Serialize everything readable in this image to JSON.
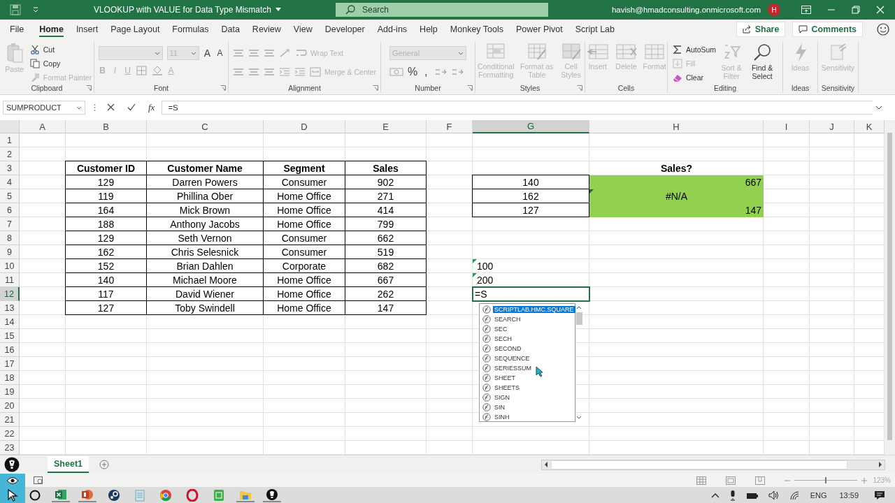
{
  "window": {
    "title": "VLOOKUP with VALUE for Data Type Mismatch",
    "search": {
      "placeholder": "Search"
    },
    "account": "havish@hmadconsulting.onmicrosoft.com",
    "avatar": "H"
  },
  "menu_tabs": [
    {
      "label": "File",
      "selected": false
    },
    {
      "label": "Home",
      "selected": true
    },
    {
      "label": "Insert",
      "selected": false
    },
    {
      "label": "Page Layout",
      "selected": false
    },
    {
      "label": "Formulas",
      "selected": false
    },
    {
      "label": "Data",
      "selected": false
    },
    {
      "label": "Review",
      "selected": false
    },
    {
      "label": "View",
      "selected": false
    },
    {
      "label": "Developer",
      "selected": false
    },
    {
      "label": "Add-ins",
      "selected": false
    },
    {
      "label": "Help",
      "selected": false
    },
    {
      "label": "Monkey Tools",
      "selected": false
    },
    {
      "label": "Power Pivot",
      "selected": false
    },
    {
      "label": "Script Lab",
      "selected": false
    }
  ],
  "share": "Share",
  "comments": "Comments",
  "ribbon": [
    {
      "kind": "clipboard",
      "name": "Clipboard",
      "buttons": [
        {
          "label": "Paste",
          "disabled": true
        },
        {
          "label": "Cut",
          "disabled": false
        },
        {
          "label": "Copy",
          "disabled": false
        },
        {
          "label": "Format Painter",
          "disabled": true
        }
      ]
    },
    {
      "kind": "font",
      "name": "Font",
      "font_size": "11",
      "buttons": [
        {
          "label": "A",
          "disabled": false
        },
        {
          "label": "A",
          "disabled": false
        },
        {
          "label": "B",
          "disabled": true
        },
        {
          "label": "I",
          "disabled": true
        },
        {
          "label": "U",
          "disabled": true
        },
        {
          "label": "A",
          "disabled": true
        }
      ]
    },
    {
      "kind": "alignment",
      "name": "Alignment",
      "buttons": [
        {
          "label": "Wrap Text",
          "disabled": true
        },
        {
          "label": "Merge & Center",
          "disabled": true
        }
      ]
    },
    {
      "kind": "number",
      "name": "Number",
      "format": "General",
      "buttons": [
        {
          "label": "%",
          "disabled": false
        },
        {
          "label": ",",
          "disabled": false
        }
      ]
    },
    {
      "kind": "styles",
      "name": "Styles",
      "buttons": [
        {
          "label": "Conditional Formatting",
          "disabled": true
        },
        {
          "label": "Format as Table",
          "disabled": true
        },
        {
          "label": "Cell Styles",
          "disabled": true
        }
      ]
    },
    {
      "kind": "cells",
      "name": "Cells",
      "buttons": [
        {
          "label": "Insert",
          "disabled": true
        },
        {
          "label": "Delete",
          "disabled": true
        },
        {
          "label": "Format",
          "disabled": true
        }
      ]
    },
    {
      "kind": "editing",
      "name": "Editing",
      "buttons": [
        {
          "label": "AutoSum",
          "disabled": false
        },
        {
          "label": "Fill",
          "disabled": true
        },
        {
          "label": "Clear",
          "disabled": false
        },
        {
          "label": "Sort & Filter",
          "disabled": true
        },
        {
          "label": "Find & Select",
          "disabled": false
        }
      ]
    },
    {
      "kind": "ideas",
      "name": "Ideas",
      "buttons": [
        {
          "label": "Ideas",
          "disabled": true
        }
      ]
    },
    {
      "kind": "sensitivity",
      "name": "Sensitivity",
      "buttons": [
        {
          "label": "Sensitivity",
          "disabled": true
        }
      ]
    }
  ],
  "formula_bar": {
    "name_box": "SUMPRODUCT",
    "function_label": "fx",
    "formula": "=S"
  },
  "sheet": {
    "columns": [
      {
        "label": "A",
        "selected": false
      },
      {
        "label": "B",
        "selected": false
      },
      {
        "label": "C",
        "selected": false
      },
      {
        "label": "D",
        "selected": false
      },
      {
        "label": "E",
        "selected": false
      },
      {
        "label": "F",
        "selected": false
      },
      {
        "label": "G",
        "selected": true
      },
      {
        "label": "H",
        "selected": false
      },
      {
        "label": "I",
        "selected": false
      },
      {
        "label": "J",
        "selected": false
      },
      {
        "label": "K",
        "selected": false
      }
    ],
    "rows": [
      {
        "label": "1",
        "selected": false
      },
      {
        "label": "2",
        "selected": false
      },
      {
        "label": "3",
        "selected": false
      },
      {
        "label": "4",
        "selected": false
      },
      {
        "label": "5",
        "selected": false
      },
      {
        "label": "6",
        "selected": false
      },
      {
        "label": "7",
        "selected": false
      },
      {
        "label": "8",
        "selected": false
      },
      {
        "label": "9",
        "selected": false
      },
      {
        "label": "10",
        "selected": false
      },
      {
        "label": "11",
        "selected": false
      },
      {
        "label": "12",
        "selected": true
      },
      {
        "label": "13",
        "selected": false
      },
      {
        "label": "14",
        "selected": false
      },
      {
        "label": "15",
        "selected": false
      },
      {
        "label": "16",
        "selected": false
      },
      {
        "label": "17",
        "selected": false
      },
      {
        "label": "18",
        "selected": false
      },
      {
        "label": "19",
        "selected": false
      },
      {
        "label": "20",
        "selected": false
      },
      {
        "label": "21",
        "selected": false
      },
      {
        "label": "22",
        "selected": false
      },
      {
        "label": "23",
        "selected": false
      }
    ],
    "table": {
      "columns": [
        "Customer ID",
        "Customer Name",
        "Segment",
        "Sales"
      ],
      "rows": [
        [
          "129",
          "Darren Powers",
          "Consumer",
          "902"
        ],
        [
          "119",
          "Phillina Ober",
          "Home Office",
          "271"
        ],
        [
          "164",
          "Mick Brown",
          "Home Office",
          "414"
        ],
        [
          "188",
          "Anthony Jacobs",
          "Home Office",
          "799"
        ],
        [
          "129",
          "Seth Vernon",
          "Consumer",
          "662"
        ],
        [
          "162",
          "Chris Selesnick",
          "Consumer",
          "519"
        ],
        [
          "152",
          "Brian Dahlen",
          "Corporate",
          "682"
        ],
        [
          "140",
          "Michael Moore",
          "Home Office",
          "667"
        ],
        [
          "117",
          "David Wiener",
          "Home Office",
          "262"
        ],
        [
          "127",
          "Toby Swindell",
          "Home Office",
          "147"
        ]
      ]
    },
    "lookup": {
      "header": "Sales?",
      "rows": [
        {
          "key": "140",
          "result": "667",
          "kind": "number",
          "highlighted": true,
          "warning": false
        },
        {
          "key": "162",
          "result": "#N/A",
          "kind": "error",
          "highlighted": true,
          "warning": true
        },
        {
          "key": "127",
          "result": "147",
          "kind": "number",
          "highlighted": true,
          "warning": false
        }
      ]
    },
    "text_values": [
      {
        "text": "100",
        "warning": true
      },
      {
        "text": "200",
        "warning": true
      }
    ],
    "active_cell": {
      "text": "=S"
    },
    "autocomplete": [
      {
        "label": "SCRIPTLAB.HMC.SQUARE",
        "selected": true
      },
      {
        "label": "SEARCH",
        "selected": false
      },
      {
        "label": "SEC",
        "selected": false
      },
      {
        "label": "SECH",
        "selected": false
      },
      {
        "label": "SECOND",
        "selected": false
      },
      {
        "label": "SEQUENCE",
        "selected": false
      },
      {
        "label": "SERIESSUM",
        "selected": false
      },
      {
        "label": "SHEET",
        "selected": false
      },
      {
        "label": "SHEETS",
        "selected": false
      },
      {
        "label": "SIGN",
        "selected": false
      },
      {
        "label": "SIN",
        "selected": false
      },
      {
        "label": "SINH",
        "selected": false
      }
    ]
  },
  "sheet_tabs": [
    {
      "label": "Sheet1",
      "selected": true
    }
  ],
  "status_bar": {
    "zoom": {
      "level": 0.5,
      "reading": "123%"
    }
  },
  "taskbar": {
    "language": "ENG",
    "time": "13:59"
  }
}
